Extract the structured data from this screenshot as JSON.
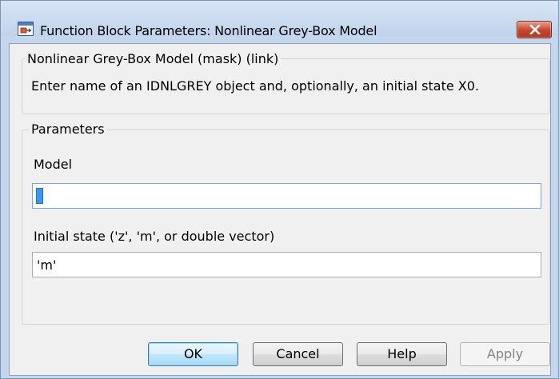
{
  "window": {
    "title": "Function Block Parameters: Nonlinear Grey-Box Model",
    "close_icon": "close-icon"
  },
  "mask_group": {
    "legend": "Nonlinear Grey-Box Model (mask) (link)",
    "description": "Enter name of an IDNLGREY object and, optionally, an initial state X0."
  },
  "parameters_group": {
    "legend": "Parameters",
    "model_label": "Model",
    "model_value": "",
    "initial_state_label": "Initial state ('z', 'm', or double vector)",
    "initial_state_value": "'m'"
  },
  "buttons": {
    "ok": "OK",
    "cancel": "Cancel",
    "help": "Help",
    "apply": "Apply"
  },
  "colors": {
    "titlebar": "#c4d7ee",
    "close_button": "#c7432b",
    "client_background": "#f0f0f0",
    "selection": "#3399ff",
    "default_button_border": "#3c7fb1"
  }
}
